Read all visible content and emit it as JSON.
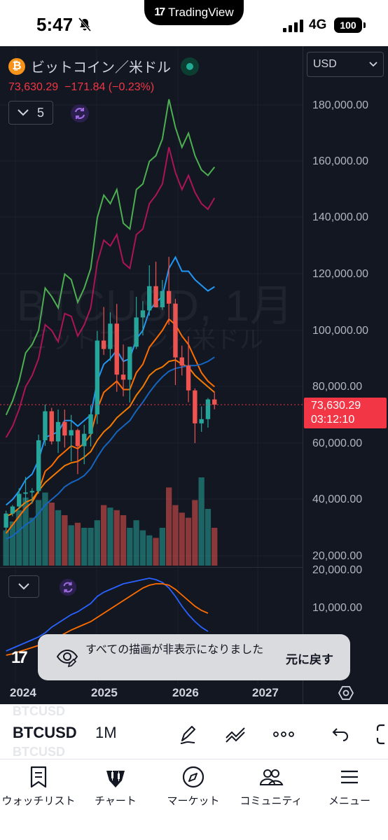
{
  "status_bar": {
    "time": "5:47",
    "app_pill": "TradingView",
    "network": "4G",
    "battery": "100"
  },
  "header": {
    "symbol_name": "ビットコイン／米ドル",
    "last_price": "73,630.29",
    "change": "−171.84 (−0.23%)",
    "indicator_count": "5",
    "currency": "USD"
  },
  "watermark": {
    "line1": "BTCUSD, 1月",
    "line2": "ビットコイン／米ドル"
  },
  "price_axis": {
    "labels": [
      "180,000.00",
      "160,000.00",
      "140,000.00",
      "120,000.00",
      "100,000.00",
      "80,000.00",
      "60,000.00",
      "40,000.00",
      "20,000.00"
    ],
    "current_price": "73,630.29",
    "countdown": "03:12:10"
  },
  "sub_pane_axis": {
    "labels": [
      "20,000.00",
      "10,000.00"
    ]
  },
  "time_axis": {
    "labels": [
      "2024",
      "2025",
      "2026",
      "2027"
    ]
  },
  "toast": {
    "message": "すべての描画が非表示になりました",
    "action": "元に戻す"
  },
  "toolbar": {
    "ticker": "BTCUSD",
    "interval": "1M",
    "ghost_ticker": "BTCUSD"
  },
  "bottom_nav": [
    {
      "label": "ウォッチリスト",
      "icon": "bookmark-list-icon"
    },
    {
      "label": "チャート",
      "icon": "candles-icon"
    },
    {
      "label": "マーケット",
      "icon": "compass-icon"
    },
    {
      "label": "コミュニティ",
      "icon": "people-icon"
    },
    {
      "label": "メニュー",
      "icon": "menu-icon"
    }
  ],
  "colors": {
    "up": "#26a69a",
    "down": "#ef5350",
    "accent_red": "#f23645",
    "bg": "#131722"
  },
  "chart_data": {
    "type": "candlestick",
    "symbol": "BTCUSD",
    "interval": "1M",
    "ylim": [
      20000,
      185000
    ],
    "x_ticks": [
      "2024",
      "2025",
      "2026",
      "2027"
    ],
    "candles": [
      {
        "o": 30000,
        "h": 36000,
        "l": 29000,
        "c": 35000
      },
      {
        "o": 35000,
        "h": 38000,
        "l": 34000,
        "c": 37500
      },
      {
        "o": 37500,
        "h": 44000,
        "l": 36500,
        "c": 42000
      },
      {
        "o": 42000,
        "h": 48000,
        "l": 38500,
        "c": 42500
      },
      {
        "o": 42500,
        "h": 44000,
        "l": 38500,
        "c": 43000
      },
      {
        "o": 43000,
        "h": 63000,
        "l": 42000,
        "c": 61000
      },
      {
        "o": 61000,
        "h": 73700,
        "l": 59000,
        "c": 71300
      },
      {
        "o": 71300,
        "h": 72500,
        "l": 59500,
        "c": 60600
      },
      {
        "o": 60600,
        "h": 71900,
        "l": 56500,
        "c": 67500
      },
      {
        "o": 67500,
        "h": 71900,
        "l": 58400,
        "c": 62700
      },
      {
        "o": 62700,
        "h": 70000,
        "l": 53500,
        "c": 64600
      },
      {
        "o": 64600,
        "h": 65100,
        "l": 49000,
        "c": 58900
      },
      {
        "o": 58900,
        "h": 66500,
        "l": 52500,
        "c": 63300
      },
      {
        "o": 63300,
        "h": 73500,
        "l": 58800,
        "c": 70200
      },
      {
        "o": 70200,
        "h": 99800,
        "l": 66800,
        "c": 96400
      },
      {
        "o": 96400,
        "h": 108300,
        "l": 91300,
        "c": 93400
      },
      {
        "o": 93400,
        "h": 106400,
        "l": 89200,
        "c": 102400
      },
      {
        "o": 102400,
        "h": 109400,
        "l": 78200,
        "c": 84300
      },
      {
        "o": 84300,
        "h": 95000,
        "l": 76600,
        "c": 82500
      },
      {
        "o": 82500,
        "h": 88700,
        "l": 74400,
        "c": 94200
      },
      {
        "o": 94200,
        "h": 111900,
        "l": 93400,
        "c": 104600
      },
      {
        "o": 104600,
        "h": 110400,
        "l": 98200,
        "c": 107100
      },
      {
        "o": 107100,
        "h": 123100,
        "l": 105200,
        "c": 115700
      },
      {
        "o": 115700,
        "h": 124400,
        "l": 108100,
        "c": 108200
      },
      {
        "o": 108200,
        "h": 117900,
        "l": 107300,
        "c": 114000
      },
      {
        "o": 114000,
        "h": 126100,
        "l": 102000,
        "c": 109500
      },
      {
        "o": 109500,
        "h": 111200,
        "l": 80600,
        "c": 90400
      },
      {
        "o": 90400,
        "h": 94600,
        "l": 84000,
        "c": 87500
      },
      {
        "o": 87500,
        "h": 97900,
        "l": 74500,
        "c": 78700
      },
      {
        "o": 78700,
        "h": 79400,
        "l": 60000,
        "c": 67000
      },
      {
        "o": 67000,
        "h": 73000,
        "l": 64000,
        "c": 68500
      },
      {
        "o": 68500,
        "h": 76000,
        "l": 65500,
        "c": 75500
      },
      {
        "o": 75500,
        "h": 78000,
        "l": 72000,
        "c": 73630
      }
    ],
    "volume": [
      28,
      35,
      44,
      54,
      38,
      52,
      58,
      50,
      44,
      40,
      32,
      34,
      30,
      30,
      36,
      48,
      46,
      44,
      40,
      30,
      36,
      28,
      24,
      22,
      30,
      62,
      48,
      42,
      38,
      52,
      70,
      45,
      30
    ],
    "series": [
      {
        "name": "",
        "color": "#4caf50",
        "values": [
          70000,
          75000,
          82000,
          92000,
          95000,
          100000,
          115000,
          112000,
          108000,
          120000,
          118000,
          110000,
          115000,
          122000,
          140000,
          148000,
          145000,
          150000,
          138000,
          136000,
          150000,
          152000,
          160000,
          162000,
          168000,
          182000,
          172000,
          165000,
          170000,
          162000,
          157000,
          155000,
          158000
        ]
      },
      {
        "name": "",
        "color": "#ad1457",
        "values": [
          62000,
          66000,
          72000,
          80000,
          84000,
          90000,
          102000,
          100000,
          96000,
          106000,
          105000,
          98000,
          102000,
          108000,
          124000,
          132000,
          130000,
          134000,
          124000,
          122000,
          134000,
          136000,
          145000,
          148000,
          152000,
          165000,
          156000,
          150000,
          155000,
          149000,
          145000,
          143000,
          147000
        ]
      },
      {
        "name": "",
        "color": "#2196f3",
        "values": [
          38000,
          40000,
          43000,
          47000,
          49000,
          54000,
          62000,
          63000,
          64000,
          68000,
          68000,
          66000,
          68000,
          70000,
          82000,
          88000,
          90000,
          93000,
          89000,
          90000,
          97000,
          100000,
          107000,
          110000,
          112000,
          122000,
          126000,
          121000,
          121000,
          118000,
          116000,
          114000,
          115500
        ]
      },
      {
        "name": "",
        "color": "#ff6d00",
        "values": [
          28000,
          31000,
          34000,
          37000,
          39000,
          43000,
          50000,
          52000,
          55000,
          57000,
          59000,
          58000,
          60000,
          63000,
          72000,
          78000,
          80000,
          82000,
          79000,
          79000,
          85000,
          88000,
          94000,
          97000,
          100000,
          104000,
          102000,
          98000,
          95000,
          90000,
          85000,
          82000,
          80000
        ]
      },
      {
        "name": "",
        "color": "#f57c00",
        "values": [
          34000,
          35000,
          37000,
          39000,
          40000,
          43000,
          46000,
          48000,
          50000,
          52000,
          53000,
          53500,
          55000,
          57000,
          61000,
          64000,
          66000,
          69000,
          71000,
          73000,
          77000,
          80000,
          84000,
          86000,
          87000,
          89000,
          89500,
          88000,
          87000,
          84000,
          82000,
          80000,
          78000
        ]
      },
      {
        "name": "",
        "color": "#1565c0",
        "values": [
          26000,
          27000,
          29000,
          31000,
          32500,
          35000,
          38000,
          40000,
          42000,
          44500,
          46000,
          47000,
          48500,
          51000,
          55000,
          58500,
          61000,
          64000,
          66000,
          68000,
          71500,
          74500,
          78000,
          81000,
          83500,
          85500,
          86500,
          87000,
          87500,
          87500,
          88000,
          89000,
          90500
        ]
      }
    ]
  }
}
